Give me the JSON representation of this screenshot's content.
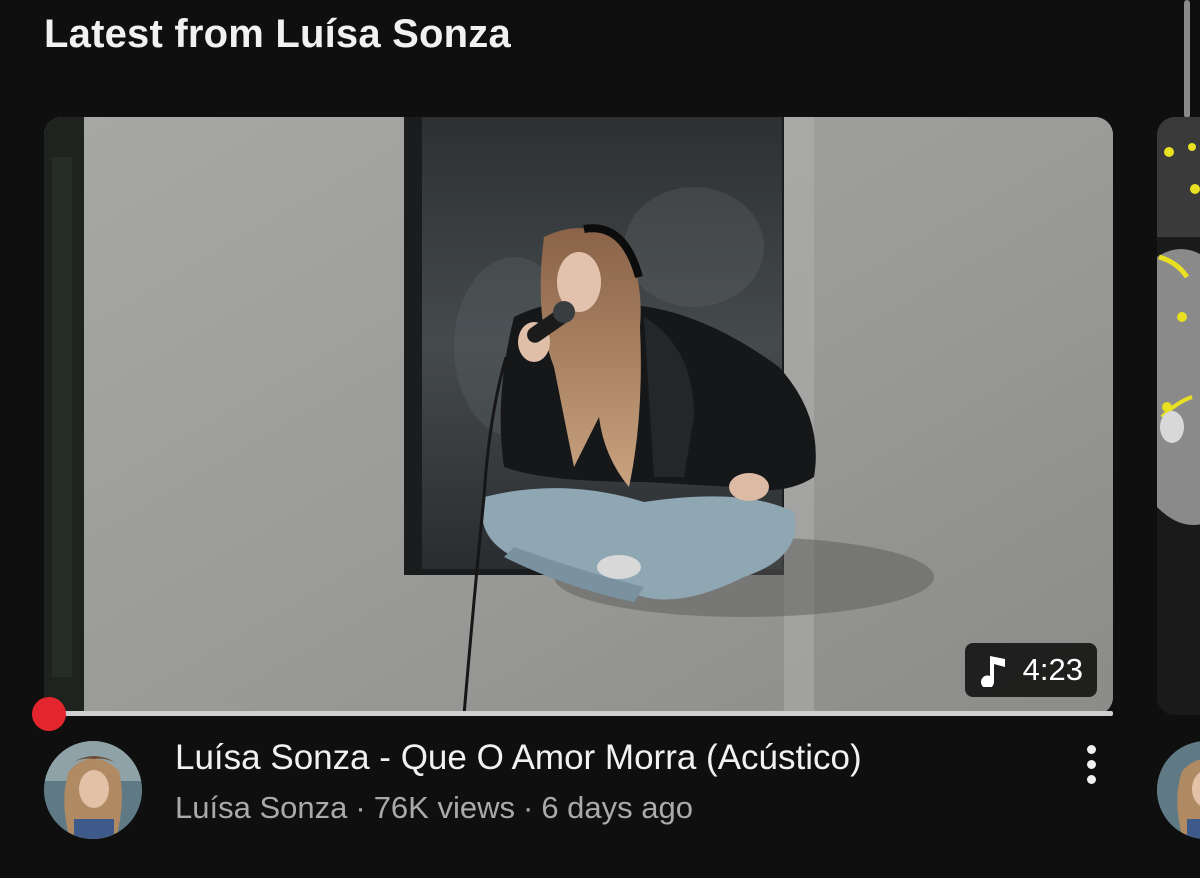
{
  "section": {
    "title": "Latest from Luísa Sonza"
  },
  "video": {
    "title": "Luísa Sonza - Que O Amor Morra (Acústico)",
    "channel": "Luísa Sonza",
    "views": "76K views",
    "age": "6 days ago",
    "separator": "·",
    "duration": "4:23",
    "duration_icon": "music-note-icon",
    "watch_progress": 0.0
  },
  "more_options_icon": "vertical-ellipsis-icon",
  "colors": {
    "background": "#0f0f0f",
    "progress_accent": "#e3262d",
    "text_primary": "#f1f1f1",
    "text_secondary": "#aaaaaa"
  }
}
